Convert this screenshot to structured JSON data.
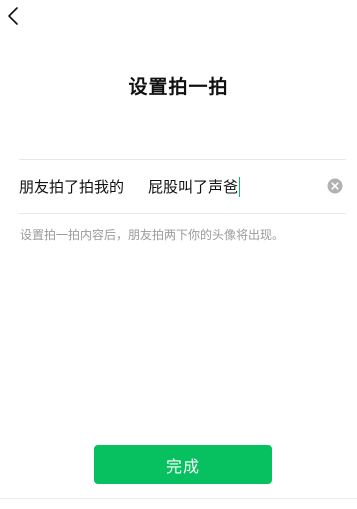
{
  "header": {
    "back_icon": "chevron-left-icon",
    "title": "设置拍一拍"
  },
  "pat_setting": {
    "prefix": "朋友拍了拍我的",
    "value": "屁股叫了声爸",
    "clear_icon": "clear-circle-icon",
    "hint": "设置拍一拍内容后，朋友拍两下你的头像将出现。"
  },
  "footer": {
    "done_label": "完成"
  },
  "colors": {
    "accent": "#07c160",
    "hint_text": "#9b9b9b",
    "clear_icon": "#b2b2b2"
  }
}
